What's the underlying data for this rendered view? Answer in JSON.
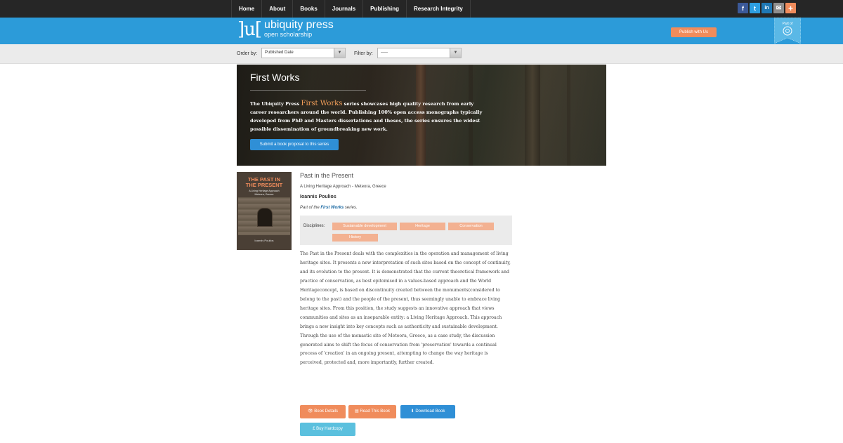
{
  "nav": {
    "items": [
      {
        "label": "Home"
      },
      {
        "label": "About"
      },
      {
        "label": "Books"
      },
      {
        "label": "Journals"
      },
      {
        "label": "Publishing"
      },
      {
        "label": "Research Integrity"
      }
    ],
    "social": [
      {
        "icon": "facebook-icon",
        "glyph": "f",
        "color": "#3b5998"
      },
      {
        "icon": "twitter-icon",
        "glyph": "t",
        "color": "#2d9ee0"
      },
      {
        "icon": "linkedin-icon",
        "glyph": "in",
        "color": "#1f78b4"
      },
      {
        "icon": "email-icon",
        "glyph": "✉",
        "color": "#8e8e8e"
      },
      {
        "icon": "share-plus-icon",
        "glyph": "+",
        "color": "#f08c5c"
      }
    ]
  },
  "header": {
    "logo_mark": "]u[",
    "logo_name": "ubiquity press",
    "logo_tagline": "open scholarship",
    "publish_label": "Publish with Us",
    "ribbon_label": "Part of",
    "header_color": "#2c9bd9",
    "accent_color": "#f08c5c"
  },
  "filters": {
    "order_label": "Order by:",
    "order_value": "Published Date",
    "filter_label": "Filter by:",
    "filter_value": "-----"
  },
  "hero": {
    "title": "First Works",
    "desc_before": "The Ubiquity Press ",
    "desc_highlight": "First Works",
    "desc_after": " series showcases high quality research from early career researchers around the world. Publishing 100% open access monographs typically developed from PhD and Masters dissertations and theses, the series ensures the widest possible dissemination of groundbreaking new work.",
    "submit_label": "Submit a book proposal to this series"
  },
  "book": {
    "title": "Past in the Present",
    "subtitle": "A Living Heritage Approach - Meteora, Greece",
    "author": "Ioannis Poulios",
    "series_prefix": "Part of the ",
    "series_name": "First Works",
    "series_suffix": " series.",
    "cover": {
      "title_line1": "THE PAST IN",
      "title_line2": "THE PRESENT",
      "subtitle_line1": "A Living Heritage Approach",
      "subtitle_line2": "Meteora, Greece",
      "author": "Ioannis Poulios"
    },
    "disciplines_label": "Disciplines:",
    "disciplines": [
      "Sustainable development",
      "Heritage",
      "Conservation",
      "History"
    ],
    "abstract": "The Past in the Present deals with the complexities in the operation and management of living heritage sites. It presents a new interpretation of such sites based on the concept of continuity, and its evolution to the present. It is demonstrated that the current theoretical framework and practice of conservation, as best epitomised in a values-based approach and the World Heritageconcept, is based on discontinuity created between the monuments(considered to belong to the past) and the people of the present, thus seemingly unable to embrace living heritage sites. From this position, the study suggests an innovative approach that views communities and sites as an inseparable entity: a Living Heritage Approach. This approach brings a new insight into key concepts such as authenticity and sustainable development. Through the use of the monastic site of Meteora, Greece, as a case study, the discussion generated aims to shift the focus of conservation from 'preservation' towards a continual process of 'creation' in an ongoing present, attempting to change the way heritage is perceived, protected and, more importantly, further created.",
    "buttons": {
      "details": "Book Details",
      "read": "Read This Book",
      "download": "Download Book",
      "hardcopy": "Buy Hardcopy"
    }
  }
}
